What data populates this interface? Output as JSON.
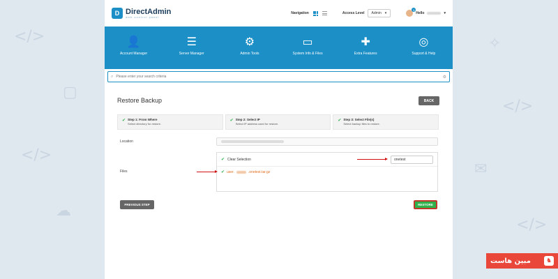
{
  "app": {
    "logo_title": "DirectAdmin",
    "logo_subtitle": "web control panel"
  },
  "header": {
    "navigation_label": "Navigation",
    "access_level_label": "Access Level",
    "access_level_value": "Admin",
    "greeting": "Hello",
    "notification_count": "1"
  },
  "menu": {
    "items": [
      {
        "label": "Account Manager",
        "icon": "account-manager-icon",
        "glyph": "👤"
      },
      {
        "label": "Server Manager",
        "icon": "server-manager-icon",
        "glyph": "☰"
      },
      {
        "label": "Admin Tools",
        "icon": "admin-tools-icon",
        "glyph": "⚙"
      },
      {
        "label": "System Info & Files",
        "icon": "system-info-icon",
        "glyph": "▭"
      },
      {
        "label": "Extra Features",
        "icon": "extra-features-icon",
        "glyph": "✚"
      },
      {
        "label": "Support & Help",
        "icon": "support-help-icon",
        "glyph": "◎"
      }
    ]
  },
  "search": {
    "placeholder": "Please enter your search criteria"
  },
  "page": {
    "title": "Restore Backup",
    "back_label": "BACK"
  },
  "steps": [
    {
      "title": "Step 1: From Where",
      "desc": "Select directory for restore."
    },
    {
      "title": "Step 2: Select IP",
      "desc": "Select IP address used for restore."
    },
    {
      "title": "Step 3: Select File(s)",
      "desc": "Select backup files to restore."
    }
  ],
  "location": {
    "label": "Location"
  },
  "files": {
    "label": "Files",
    "clear_selection": "Clear Selection",
    "filter_value": "onetest",
    "file_prefix": "user.",
    "file_suffix": ".onetest.tar.gz"
  },
  "actions": {
    "previous_label": "PREVIOUS STEP",
    "restore_label": "RESTORE"
  },
  "brand": {
    "text": "مبين هاست"
  },
  "colors": {
    "accent": "#1b8fc6",
    "success": "#2fb24c",
    "highlight": "#c0392b"
  }
}
